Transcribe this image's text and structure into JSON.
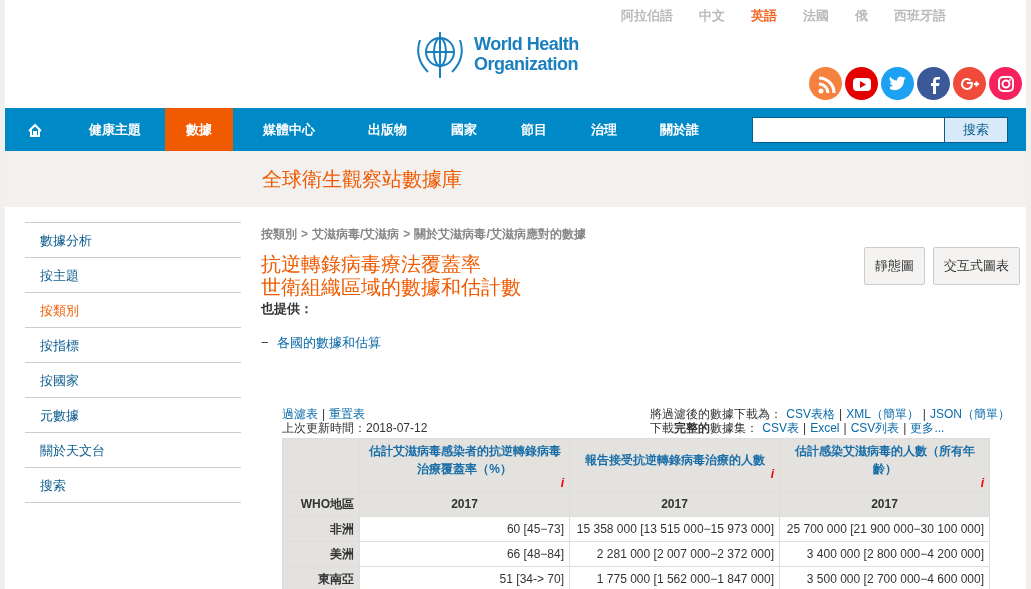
{
  "languages": [
    {
      "label": "阿拉伯語",
      "selected": false
    },
    {
      "label": "中文",
      "selected": false
    },
    {
      "label": "英語",
      "selected": true
    },
    {
      "label": "法國",
      "selected": false
    },
    {
      "label": "俄",
      "selected": false
    },
    {
      "label": "西班牙語",
      "selected": false
    }
  ],
  "logo": {
    "line1": "World Health",
    "line2": "Organization"
  },
  "social": [
    {
      "kind": "rss",
      "color": "#f5813f"
    },
    {
      "kind": "youtube",
      "color": "#e50000"
    },
    {
      "kind": "twitter",
      "color": "#1da1f2"
    },
    {
      "kind": "facebook",
      "color": "#3b5998"
    },
    {
      "kind": "googleplus",
      "color": "#f04a3b"
    },
    {
      "kind": "instagram",
      "color": "#f8215e"
    }
  ],
  "nav": [
    {
      "kind": "home",
      "selected": false
    },
    {
      "kind": "text",
      "label": "健康主題",
      "selected": false
    },
    {
      "kind": "text",
      "label": "數據",
      "selected": true
    },
    {
      "kind": "text",
      "label": "媒體中心",
      "selected": false
    },
    {
      "kind": "text",
      "label": "出版物",
      "selected": false
    },
    {
      "kind": "text",
      "label": "國家",
      "selected": false
    },
    {
      "kind": "text",
      "label": "節目",
      "selected": false
    },
    {
      "kind": "text",
      "label": "治理",
      "selected": false
    },
    {
      "kind": "text",
      "label": "關於誰",
      "selected": false
    }
  ],
  "search": {
    "button": "搜索"
  },
  "banner_title": "全球衛生觀察站數據庫",
  "sidebar": {
    "items": [
      {
        "label": "數據分析",
        "selected": false
      },
      {
        "label": "按主題",
        "selected": false
      },
      {
        "label": "按類別",
        "selected": true
      },
      {
        "label": "按指標",
        "selected": false
      },
      {
        "label": "按國家",
        "selected": false
      },
      {
        "label": "元數據",
        "selected": false
      },
      {
        "label": "關於天文台",
        "selected": false
      },
      {
        "label": "搜索",
        "selected": false
      }
    ]
  },
  "breadcrumb": [
    "按類別",
    "艾滋病毒/艾滋病",
    "關於艾滋病毒/艾滋病應對的數據"
  ],
  "breadcrumb_separator": ">",
  "title_lines": [
    "抗逆轉錄病毒療法覆蓋率",
    "世衛組織區域的數據和估計數"
  ],
  "view_buttons": [
    "靜態圖",
    "交互式圖表"
  ],
  "also_provided": "也提供：",
  "related": {
    "marker": "−",
    "link": "各國的數據和估算"
  },
  "link_separator": "|",
  "filter_links": [
    "過濾表",
    "重置表"
  ],
  "last_updated": "上次更新時間：2018-07-12",
  "download_filtered": {
    "label": "將過濾後的數據下載為：",
    "links": [
      "CSV表格",
      "XML（簡單）",
      "JSON（簡單）"
    ]
  },
  "download_full": {
    "label": "下載**完整的**數據集：",
    "links": [
      "CSV表",
      "Excel",
      "CSV列表",
      "更多..."
    ]
  },
  "table": {
    "columns": [
      {
        "label": "估計艾滋病毒感染者的抗逆轉錄病毒治療覆蓋率（%）",
        "info": "i",
        "year": "2017"
      },
      {
        "label": "報告接受抗逆轉錄病毒治療的人數",
        "info": "i",
        "year": "2017"
      },
      {
        "label": "估計感染艾滋病毒的人數（所有年齡）",
        "info": "i",
        "year": "2017"
      }
    ],
    "row_header_label": "WHO地區",
    "rows": [
      {
        "region": "非洲",
        "values": [
          "60 [45−73]",
          "15 358 000 [13 515 000−15 973 000]",
          "25 700 000 [21 900 000−30 100 000]"
        ]
      },
      {
        "region": "美洲",
        "values": [
          "66 [48−84]",
          "2 281 000 [2 007 000−2 372 000]",
          "3 400 000 [2 800 000−4 200 000]"
        ]
      },
      {
        "region": "東南亞",
        "values": [
          "51 [34-> 70]",
          "1 775 000 [1 562 000−1 847 000]",
          "3 500 000 [2 700 000−4 600 000]"
        ]
      }
    ]
  }
}
